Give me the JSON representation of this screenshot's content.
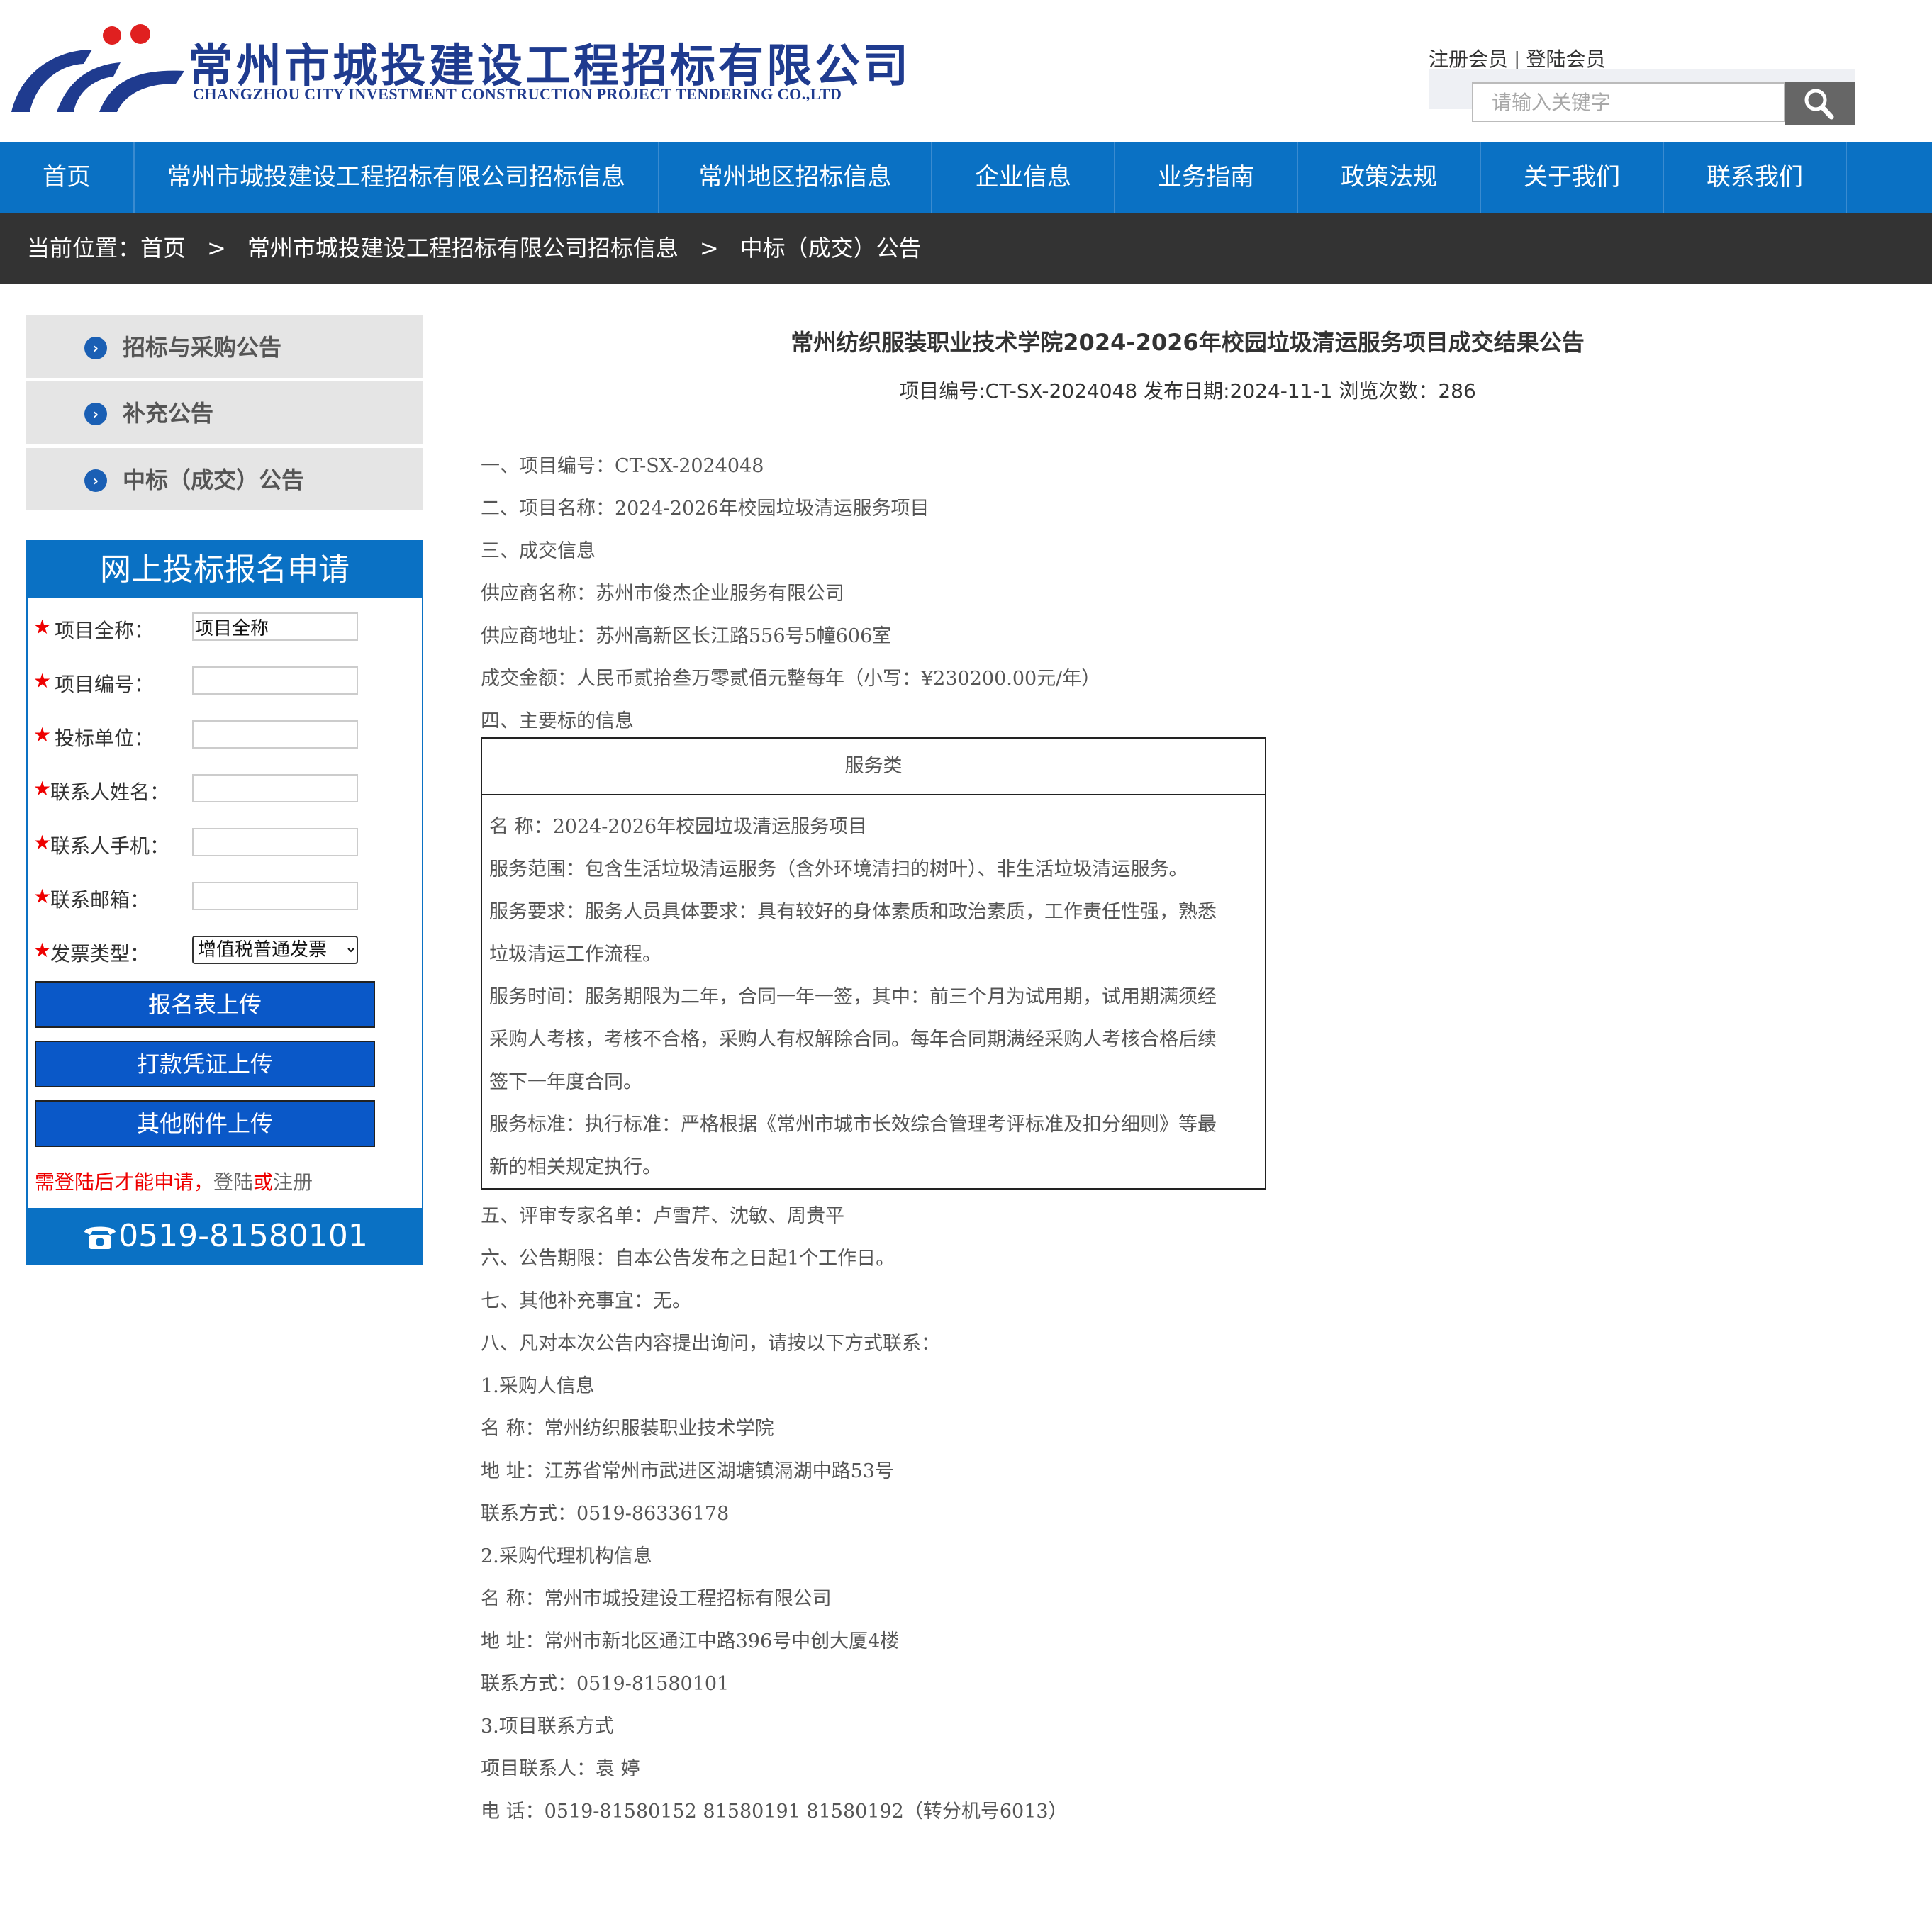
{
  "header": {
    "logo_cn": "常州市城投建设工程招标有限公司",
    "logo_en": "CHANGZHOU CITY INVESTMENT CONSTRUCTION PROJECT TENDERING CO.,LTD",
    "register": "注册会员",
    "separator": "|",
    "login": "登陆会员",
    "search_placeholder": "请输入关键字"
  },
  "nav": [
    "首页",
    "常州市城投建设工程招标有限公司招标信息",
    "常州地区招标信息",
    "企业信息",
    "业务指南",
    "政策法规",
    "关于我们",
    "联系我们"
  ],
  "breadcrumb": {
    "prefix": "当前位置：",
    "items": [
      "首页",
      "常州市城投建设工程招标有限公司招标信息",
      "中标（成交）公告"
    ],
    "arrow": ">"
  },
  "sidebar": {
    "menu": [
      "招标与采购公告",
      "补充公告",
      "中标（成交）公告"
    ],
    "apply_title": "网上投标报名申请",
    "fields": [
      {
        "label": "项目全称：",
        "value": "项目全称"
      },
      {
        "label": "项目编号：",
        "value": ""
      },
      {
        "label": "投标单位：",
        "value": ""
      },
      {
        "label": "联系人姓名：",
        "value": ""
      },
      {
        "label": "联系人手机：",
        "value": ""
      },
      {
        "label": "联系邮箱：",
        "value": ""
      },
      {
        "label": "发票类型：",
        "value": "增值税普通发票"
      }
    ],
    "star": "★",
    "buttons": [
      "报名表上传",
      "打款凭证上传",
      "其他附件上传"
    ],
    "tip_red": "需登陆后才能申请，",
    "tip_login": "登陆",
    "tip_or": "或",
    "tip_register": "注册",
    "phone": "0519-81580101"
  },
  "article": {
    "title": "常州纺织服装职业技术学院2024-2026年校园垃圾清运服务项目成交结果公告",
    "meta": "项目编号:CT-SX-2024048 发布日期:2024-11-1   浏览次数：286",
    "paras_top": [
      "一、项目编号：CT-SX-2024048",
      "二、项目名称：2024-2026年校园垃圾清运服务项目",
      "三、成交信息",
      "供应商名称：苏州市俊杰企业服务有限公司",
      "供应商地址：苏州高新区长江路556号5幢606室",
      "成交金额：人民币贰拾叁万零贰佰元整每年（小写：¥230200.00元/年）",
      "四、主要标的信息"
    ],
    "table_head": "服务类",
    "table_lines": [
      "名        称：2024-2026年校园垃圾清运服务项目",
      "服务范围：包含生活垃圾清运服务（含外环境清扫的树叶）、非生活垃圾清运服务。",
      "服务要求：服务人员具体要求：具有较好的身体素质和政治素质，工作责任性强，熟悉",
      "垃圾清运工作流程。",
      "服务时间：服务期限为二年，合同一年一签，其中：前三个月为试用期，试用期满须经",
      "采购人考核，考核不合格，采购人有权解除合同。每年合同期满经采购人考核合格后续",
      "签下一年度合同。",
      "服务标准：执行标准：严格根据《常州市城市长效综合管理考评标准及扣分细则》等最",
      "新的相关规定执行。"
    ],
    "paras_bottom": [
      "五、评审专家名单：卢雪芹、沈敏、周贵平",
      "六、公告期限：自本公告发布之日起1个工作日。",
      "七、其他补充事宜：无。",
      "八、凡对本次公告内容提出询问，请按以下方式联系：",
      "1.采购人信息",
      "名        称：常州纺织服装职业技术学院",
      "地        址：江苏省常州市武进区湖塘镇滆湖中路53号",
      "联系方式：0519-86336178",
      "2.采购代理机构信息",
      "名    称：常州市城投建设工程招标有限公司",
      "地    址：常州市新北区通江中路396号中创大厦4楼",
      "联系方式：0519-81580101",
      "3.项目联系方式",
      "项目联系人：袁   婷",
      "电        话：0519-81580152    81580191    81580192（转分机号6013）"
    ]
  },
  "colors": {
    "nav_blue": "#0a71c4",
    "crumb_bg": "#333333",
    "button_blue": "#0a58c8",
    "required_red": "#e00000"
  }
}
